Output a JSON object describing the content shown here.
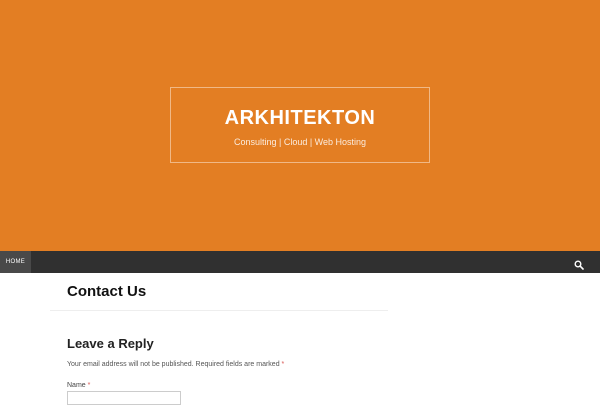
{
  "header": {
    "site_title": "ARKHITEKTON",
    "site_description": "Consulting | Cloud | Web Hosting",
    "background_color": "#e37e23"
  },
  "nav": {
    "items": [
      {
        "label": "HOME",
        "active": true
      }
    ],
    "search_icon": "search-icon",
    "background_color": "#303030"
  },
  "page": {
    "title": "Contact Us"
  },
  "comment_form": {
    "title": "Leave a Reply",
    "notes": "Your email address will not be published. Required fields are marked",
    "required_marker": "*",
    "fields": [
      {
        "label": "Name",
        "value": "",
        "required": true
      }
    ]
  }
}
